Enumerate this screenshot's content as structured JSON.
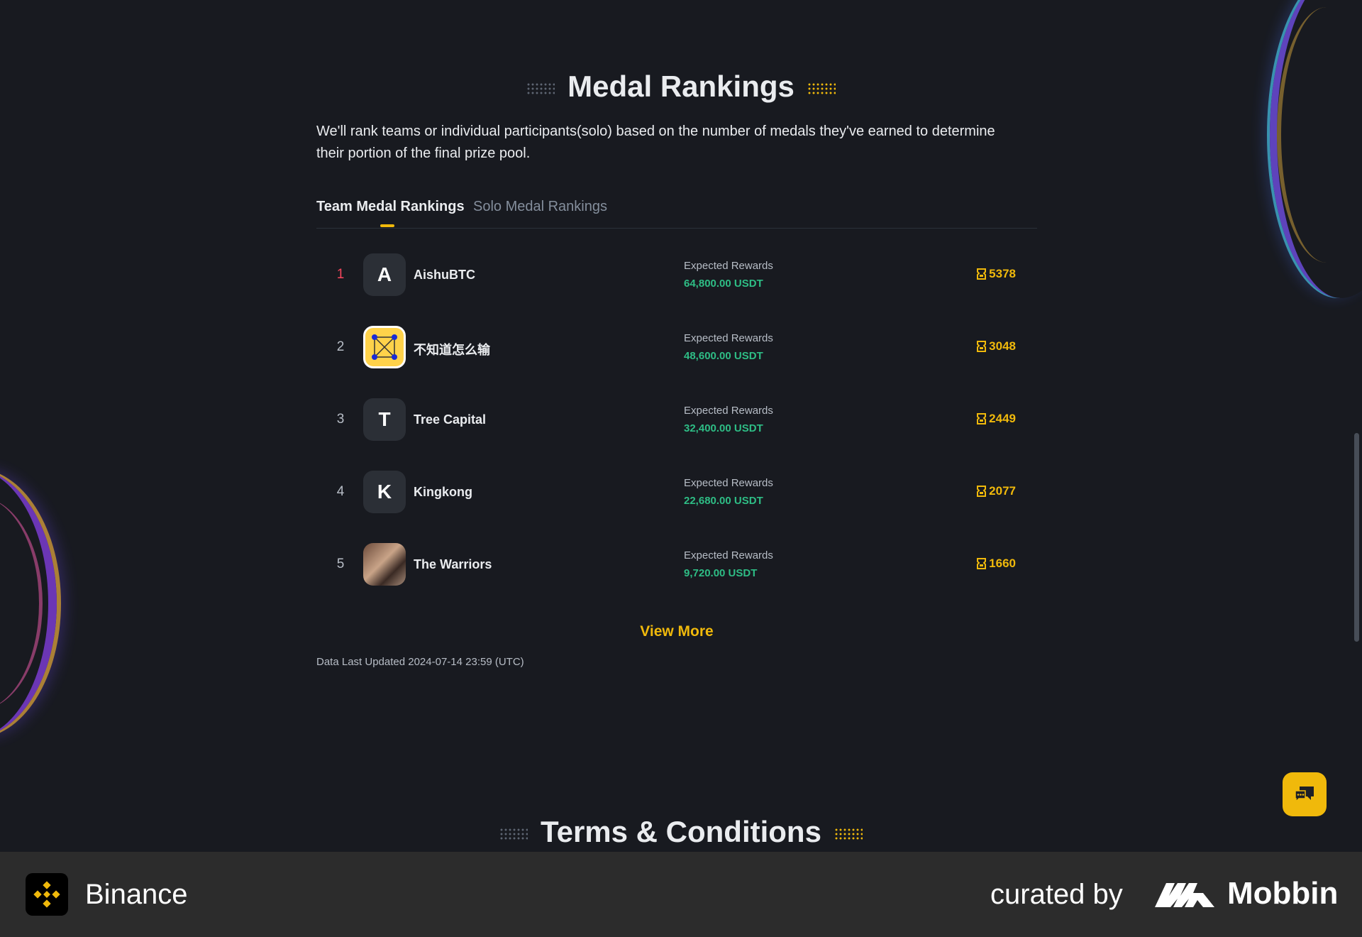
{
  "section": {
    "title": "Medal Rankings",
    "description": "We'll rank teams or individual participants(solo) based on the number of medals they've earned to determine their portion of the final prize pool."
  },
  "tabs": [
    {
      "label": "Team Medal Rankings",
      "active": true
    },
    {
      "label": "Solo Medal Rankings",
      "active": false
    }
  ],
  "rankings": [
    {
      "rank": "1",
      "avatar_letter": "A",
      "name": "AishuBTC",
      "reward_label": "Expected Rewards",
      "reward_value": "64,800.00 USDT",
      "medals": "5378"
    },
    {
      "rank": "2",
      "avatar_letter": "",
      "name": "不知道怎么输",
      "reward_label": "Expected Rewards",
      "reward_value": "48,600.00 USDT",
      "medals": "3048"
    },
    {
      "rank": "3",
      "avatar_letter": "T",
      "name": "Tree Capital",
      "reward_label": "Expected Rewards",
      "reward_value": "32,400.00 USDT",
      "medals": "2449"
    },
    {
      "rank": "4",
      "avatar_letter": "K",
      "name": "Kingkong",
      "reward_label": "Expected Rewards",
      "reward_value": "22,680.00 USDT",
      "medals": "2077"
    },
    {
      "rank": "5",
      "avatar_letter": "",
      "name": "The Warriors",
      "reward_label": "Expected Rewards",
      "reward_value": "9,720.00 USDT",
      "medals": "1660"
    }
  ],
  "view_more_label": "View More",
  "updated_text": "Data Last Updated 2024-07-14 23:59 (UTC)",
  "terms_title": "Terms & Conditions",
  "chat_icon": "chat-bubbles-icon",
  "footer": {
    "brand_name": "Binance",
    "curated_label": "curated by",
    "curator_name": "Mobbin"
  },
  "colors": {
    "accent": "#f0b90b",
    "reward_green": "#2ebd85",
    "first_rank": "#f6465d",
    "background": "#181a20"
  }
}
